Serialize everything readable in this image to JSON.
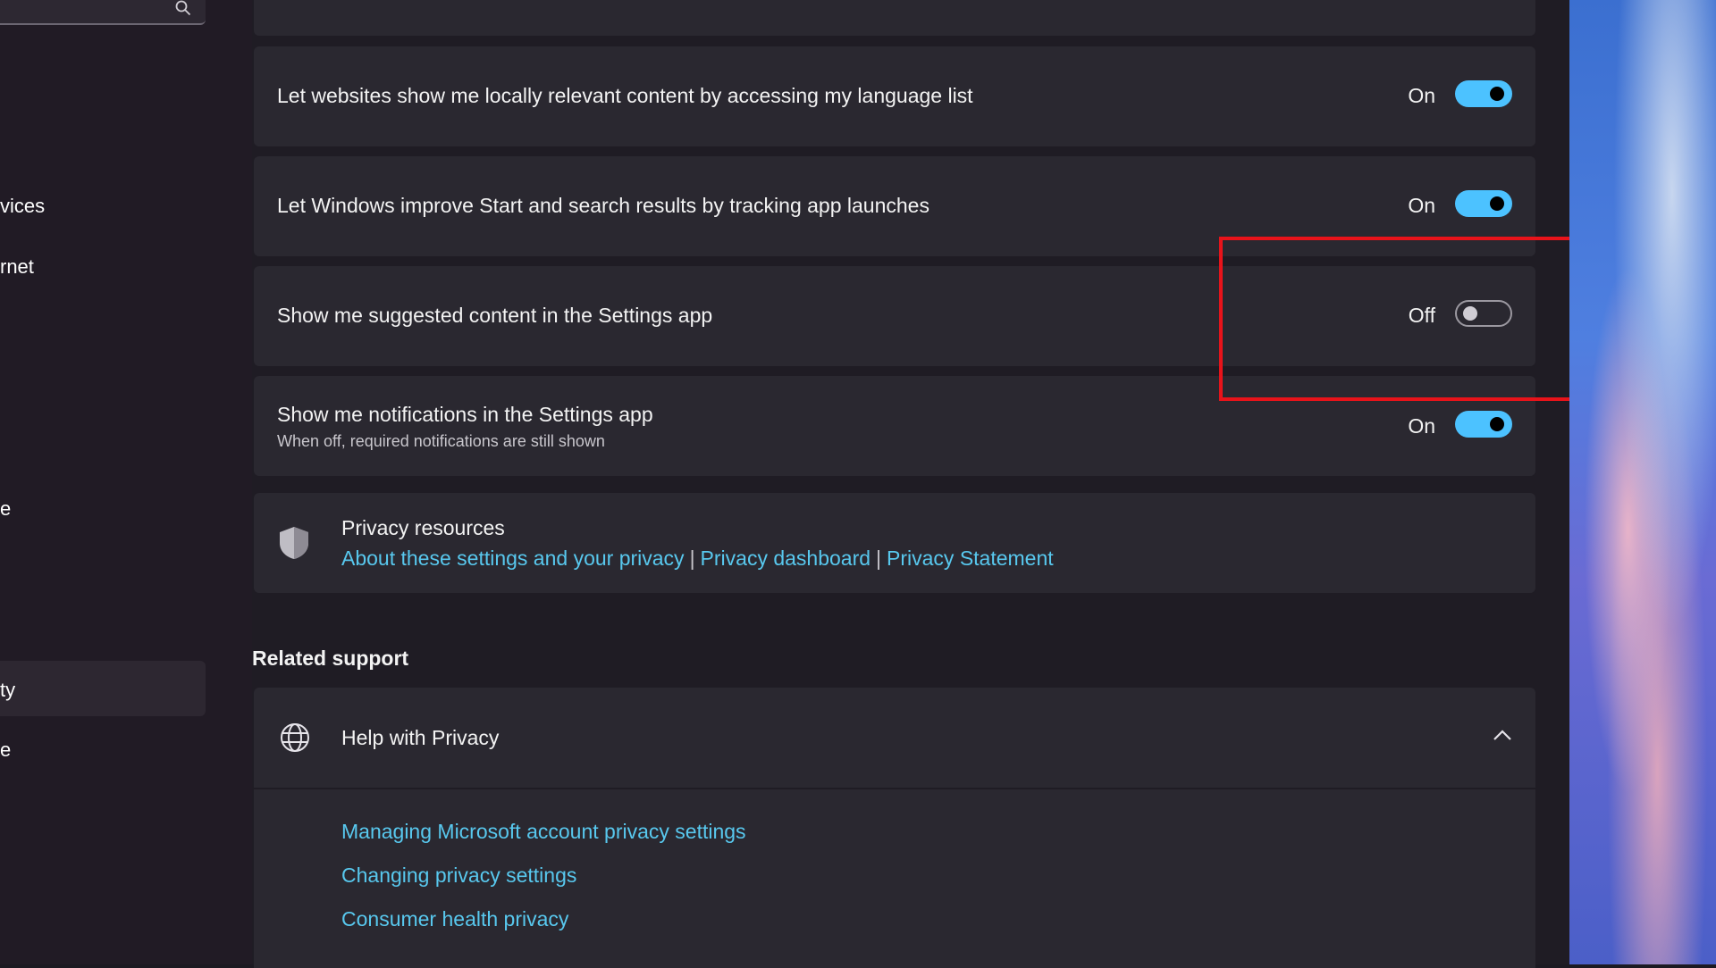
{
  "sidebar": {
    "nav_items": [
      "vices",
      "rnet",
      "e",
      "ty",
      "e"
    ]
  },
  "settings": [
    {
      "label": "Let websites show me locally relevant content by accessing my language list",
      "state": "On"
    },
    {
      "label": "Let Windows improve Start and search results by tracking app launches",
      "state": "On"
    },
    {
      "label": "Show me suggested content in the Settings app",
      "state": "Off"
    },
    {
      "label": "Show me notifications in the Settings app",
      "sublabel": "When off, required notifications are still shown",
      "state": "On"
    }
  ],
  "privacy_resources": {
    "title": "Privacy resources",
    "links": [
      "About these settings and your privacy",
      "Privacy dashboard",
      "Privacy Statement"
    ],
    "separator": "|"
  },
  "related_support": {
    "title": "Related support",
    "help": {
      "title": "Help with Privacy",
      "links": [
        "Managing Microsoft account privacy settings",
        "Changing privacy settings",
        "Consumer health privacy"
      ]
    }
  },
  "colors": {
    "accent": "#4cc2ff",
    "link": "#58c8ee",
    "highlight": "#e8131a"
  },
  "icons": [
    "search-icon",
    "shield-icon",
    "globe-icon",
    "chevron-up-icon"
  ]
}
